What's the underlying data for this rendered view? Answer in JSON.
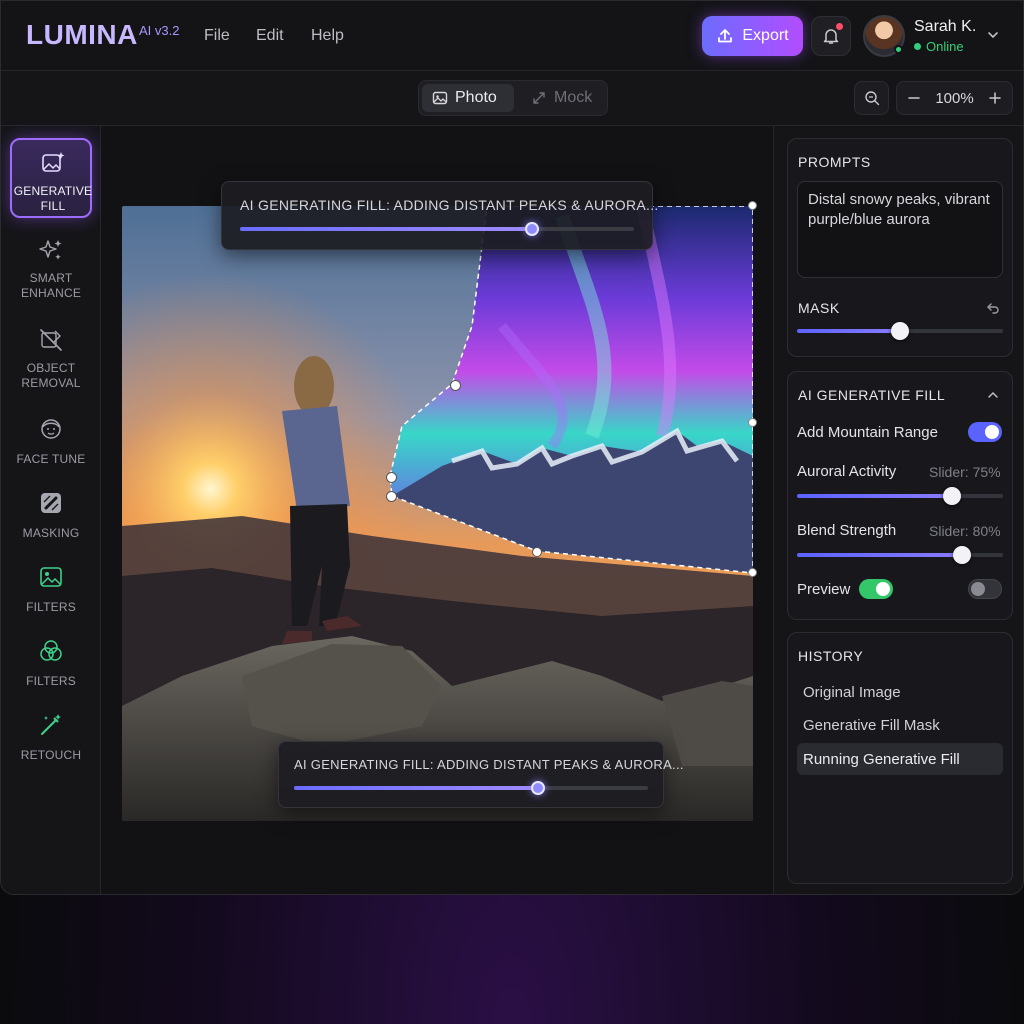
{
  "app": {
    "name": "LUMINA",
    "version": "AI v3.2",
    "menu": [
      "File",
      "Edit",
      "Help"
    ],
    "export_label": "Export",
    "user": {
      "name": "Sarah K.",
      "status": "Online"
    }
  },
  "view_toggle": {
    "photo_label": "Photo",
    "mock_label": "Mock",
    "selected": "Photo"
  },
  "zoom": {
    "value": "100%"
  },
  "tools": [
    {
      "label": "GENERATIVE FILL",
      "icon": "image-sparkle-icon",
      "active": true
    },
    {
      "label": "SMART ENHANCE",
      "icon": "sparkles-icon",
      "active": false
    },
    {
      "label": "OBJECT REMOVAL",
      "icon": "object-removal-icon",
      "active": false
    },
    {
      "label": "FACE TUNE",
      "icon": "face-icon",
      "active": false
    },
    {
      "label": "MASKING",
      "icon": "mask-icon",
      "active": false
    },
    {
      "label": "FILTERS",
      "icon": "image-icon",
      "active": false
    },
    {
      "label": "FILTERS",
      "icon": "color-circles-icon",
      "active": false
    },
    {
      "label": "RETOUCH",
      "icon": "magic-wand-icon",
      "active": false
    }
  ],
  "canvas": {
    "progress_top": {
      "text": "AI GENERATING FILL: ADDING DISTANT PEAKS & AURORA...",
      "progress": 0.74
    },
    "progress_bottom": {
      "text": "AI GENERATING FILL: ADDING DISTANT PEAKS & AURORA...",
      "progress": 0.69
    }
  },
  "prompts": {
    "title": "PROMPTS",
    "text": "Distal snowy peaks, vibrant purple/blue aurora"
  },
  "mask": {
    "title": "MASK",
    "value": 0.5
  },
  "ai_fill": {
    "title": "AI GENERATIVE FILL",
    "add_mountain_label": "Add Mountain Range",
    "add_mountain_on": true,
    "auroral_label": "Auroral Activity",
    "auroral_value_text": "Slider: 75%",
    "auroral_value": 0.75,
    "blend_label": "Blend Strength",
    "blend_value_text": "Slider: 80%",
    "blend_value": 0.8,
    "preview_label": "Preview",
    "preview_on": true,
    "second_toggle_on": false
  },
  "history": {
    "title": "HISTORY",
    "items": [
      "Original Image",
      "Generative Fill Mask",
      "Running Generative Fill"
    ],
    "selected_index": 2
  },
  "colors": {
    "accent": "#8a6cff",
    "export_gradient_start": "#6c6cff",
    "export_gradient_end": "#b24dff",
    "online": "#31d07a",
    "toggle_on_blue": "#5b63ff",
    "toggle_on_green": "#34c76a"
  }
}
